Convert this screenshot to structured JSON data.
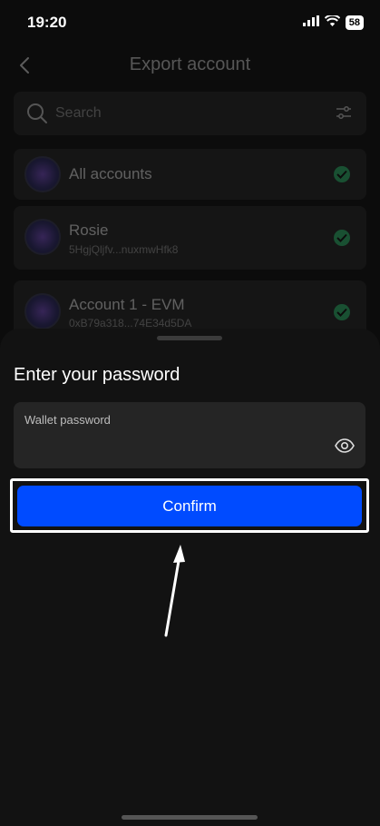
{
  "status_bar": {
    "time": "19:20",
    "battery": "58"
  },
  "header": {
    "title": "Export account"
  },
  "search": {
    "placeholder": "Search"
  },
  "accounts": [
    {
      "name": "All accounts",
      "address": ""
    },
    {
      "name": "Rosie",
      "address": "5HgjQljfv...nuxmwHfk8"
    },
    {
      "name": "Account 1 - EVM",
      "address": "0xB79a318...74E34d5DA"
    }
  ],
  "sheet": {
    "title": "Enter your password",
    "password_label": "Wallet password",
    "password_value": "",
    "confirm_label": "Confirm"
  },
  "colors": {
    "accent": "#004bff",
    "check": "#2fbf71",
    "background": "#0c0c0c",
    "card": "#252525"
  },
  "icons": [
    "back-icon",
    "search-icon",
    "filter-icon",
    "check-icon",
    "eye-icon",
    "signal-icon",
    "wifi-icon"
  ]
}
